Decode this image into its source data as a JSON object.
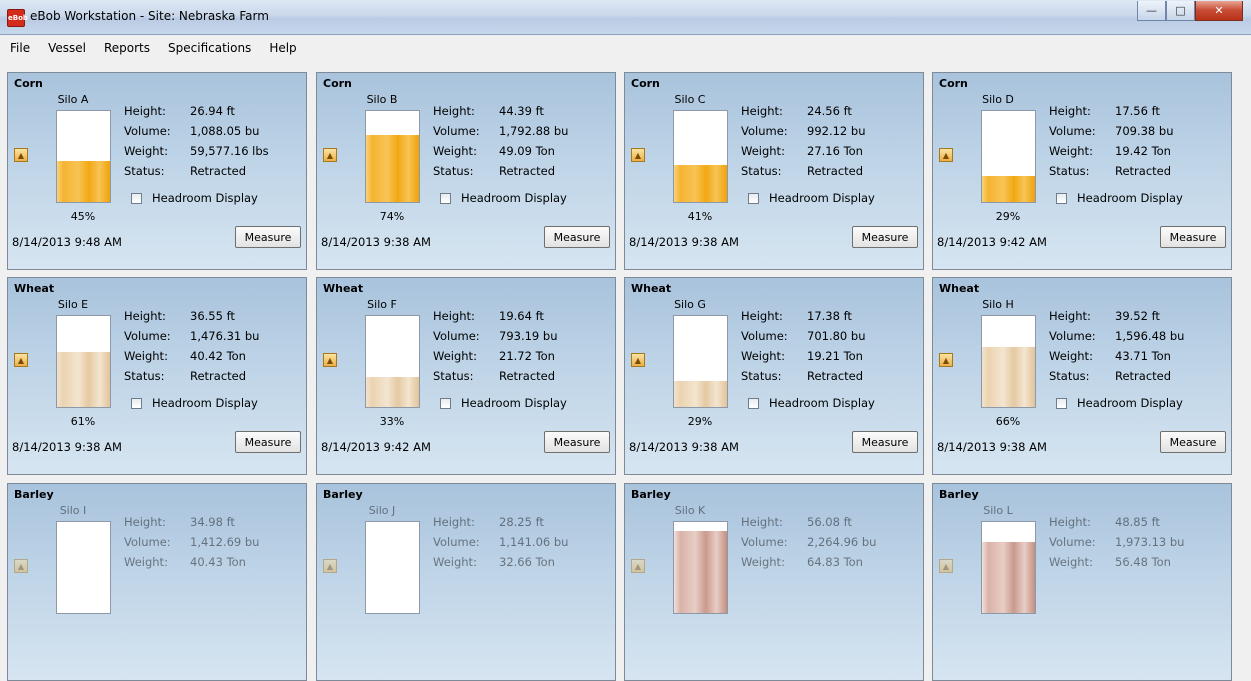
{
  "window": {
    "title": "eBob Workstation - Site: Nebraska Farm",
    "icon": "app-icon"
  },
  "menu": [
    "File",
    "Vessel",
    "Reports",
    "Specifications",
    "Help"
  ],
  "labels": {
    "height": "Height:",
    "volume": "Volume:",
    "weight": "Weight:",
    "status": "Status:",
    "headroom": "Headroom Display",
    "measure": "Measure"
  },
  "silos": [
    {
      "grain": "Corn",
      "name": "Silo A",
      "height": "26.94 ft",
      "volume": "1,088.05 bu",
      "weight": "59,577.16 lbs",
      "status": "Retracted",
      "percent": "45%",
      "fill": 0.45,
      "date": "8/14/2013 9:48 AM"
    },
    {
      "grain": "Corn",
      "name": "Silo B",
      "height": "44.39 ft",
      "volume": "1,792.88 bu",
      "weight": "49.09 Ton",
      "status": "Retracted",
      "percent": "74%",
      "fill": 0.74,
      "date": "8/14/2013 9:38 AM"
    },
    {
      "grain": "Corn",
      "name": "Silo C",
      "height": "24.56 ft",
      "volume": "992.12 bu",
      "weight": "27.16 Ton",
      "status": "Retracted",
      "percent": "41%",
      "fill": 0.41,
      "date": "8/14/2013 9:38 AM"
    },
    {
      "grain": "Corn",
      "name": "Silo D",
      "height": "17.56 ft",
      "volume": "709.38 bu",
      "weight": "19.42 Ton",
      "status": "Retracted",
      "percent": "29%",
      "fill": 0.29,
      "date": "8/14/2013 9:42 AM"
    },
    {
      "grain": "Wheat",
      "name": "Silo E",
      "height": "36.55 ft",
      "volume": "1,476.31 bu",
      "weight": "40.42 Ton",
      "status": "Retracted",
      "percent": "61%",
      "fill": 0.61,
      "date": "8/14/2013 9:38 AM"
    },
    {
      "grain": "Wheat",
      "name": "Silo F",
      "height": "19.64 ft",
      "volume": "793.19 bu",
      "weight": "21.72 Ton",
      "status": "Retracted",
      "percent": "33%",
      "fill": 0.33,
      "date": "8/14/2013 9:42 AM"
    },
    {
      "grain": "Wheat",
      "name": "Silo G",
      "height": "17.38 ft",
      "volume": "701.80 bu",
      "weight": "19.21 Ton",
      "status": "Retracted",
      "percent": "29%",
      "fill": 0.29,
      "date": "8/14/2013 9:38 AM"
    },
    {
      "grain": "Wheat",
      "name": "Silo H",
      "height": "39.52 ft",
      "volume": "1,596.48 bu",
      "weight": "43.71 Ton",
      "status": "Retracted",
      "percent": "66%",
      "fill": 0.66,
      "date": "8/14/2013 9:38 AM"
    },
    {
      "grain": "Barley",
      "name": "Silo I",
      "height": "34.98 ft",
      "volume": "1,412.69 bu",
      "weight": "40.43 Ton",
      "status": "",
      "percent": "",
      "fill": 0.0,
      "date": ""
    },
    {
      "grain": "Barley",
      "name": "Silo J",
      "height": "28.25 ft",
      "volume": "1,141.06 bu",
      "weight": "32.66 Ton",
      "status": "",
      "percent": "",
      "fill": 0.0,
      "date": ""
    },
    {
      "grain": "Barley",
      "name": "Silo K",
      "height": "56.08 ft",
      "volume": "2,264.96 bu",
      "weight": "64.83 Ton",
      "status": "",
      "percent": "",
      "fill": 0.9,
      "date": ""
    },
    {
      "grain": "Barley",
      "name": "Silo L",
      "height": "48.85 ft",
      "volume": "1,973.13 bu",
      "weight": "56.48 Ton",
      "status": "",
      "percent": "",
      "fill": 0.78,
      "date": ""
    }
  ]
}
